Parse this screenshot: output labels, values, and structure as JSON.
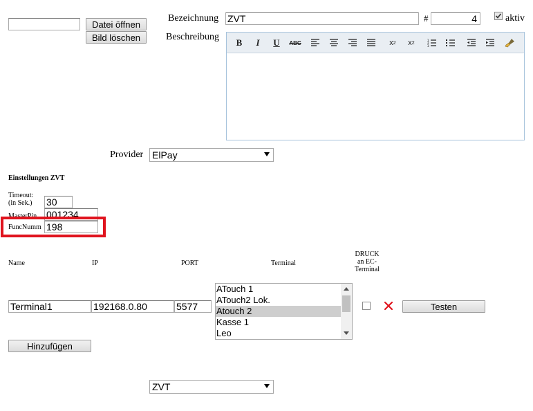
{
  "top": {
    "file_input_value": "",
    "open_file_label": "Datei öffnen",
    "delete_image_label": "Bild löschen",
    "bezeichnung_label": "Bezeichnung",
    "bezeichnung_value": "ZVT",
    "hash_label": "#",
    "number_value": "4",
    "aktiv_label": "aktiv",
    "aktiv_checked": true,
    "beschreibung_label": "Beschreibung"
  },
  "editor": {
    "toolbar": [
      {
        "name": "bold-icon",
        "glyph": "B"
      },
      {
        "name": "italic-icon",
        "glyph": "I"
      },
      {
        "name": "underline-icon",
        "glyph": "U"
      },
      {
        "name": "strikethrough-icon",
        "glyph": "ABC"
      },
      {
        "name": "align-left-icon",
        "glyph": ""
      },
      {
        "name": "align-center-icon",
        "glyph": ""
      },
      {
        "name": "align-right-icon",
        "glyph": ""
      },
      {
        "name": "align-justify-icon",
        "glyph": ""
      },
      {
        "name": "subscript-icon",
        "glyph": "x₂"
      },
      {
        "name": "superscript-icon",
        "glyph": "x²"
      },
      {
        "name": "ordered-list-icon",
        "glyph": ""
      },
      {
        "name": "unordered-list-icon",
        "glyph": ""
      },
      {
        "name": "outdent-icon",
        "glyph": ""
      },
      {
        "name": "indent-icon",
        "glyph": ""
      },
      {
        "name": "clean-brush-icon",
        "glyph": ""
      }
    ],
    "content": ""
  },
  "provider": {
    "label": "Provider",
    "selected": "ElPay"
  },
  "settings": {
    "heading": "Einstellungen ZVT",
    "timeout_label_1": "Timeout:",
    "timeout_label_2": "(in Sek.)",
    "timeout_value": "30",
    "masterpin_label": "MasterPin",
    "masterpin_value": "001234",
    "funcnumm_label": "FuncNumm",
    "funcnumm_value": "198",
    "highlight_color": "#e0141e"
  },
  "table": {
    "headers": {
      "name": "Name",
      "ip": "IP",
      "port": "PORT",
      "terminal": "Terminal",
      "druck_1": "DRUCK",
      "druck_2": "an EC-",
      "druck_3": "Terminal"
    },
    "row": {
      "name": "Terminal1",
      "ip": "192168.0.80",
      "port": "5577",
      "druck_checked": false,
      "test_label": "Testen"
    },
    "terminal_options": [
      "ATouch 1",
      "ATouch2 Lok.",
      "Atouch 2",
      "Kasse 1",
      "Leo"
    ],
    "terminal_selected_index": 2,
    "delete_color": "#e0141e"
  },
  "add_label": "Hinzufügen",
  "bottom_select": {
    "selected": "ZVT"
  }
}
